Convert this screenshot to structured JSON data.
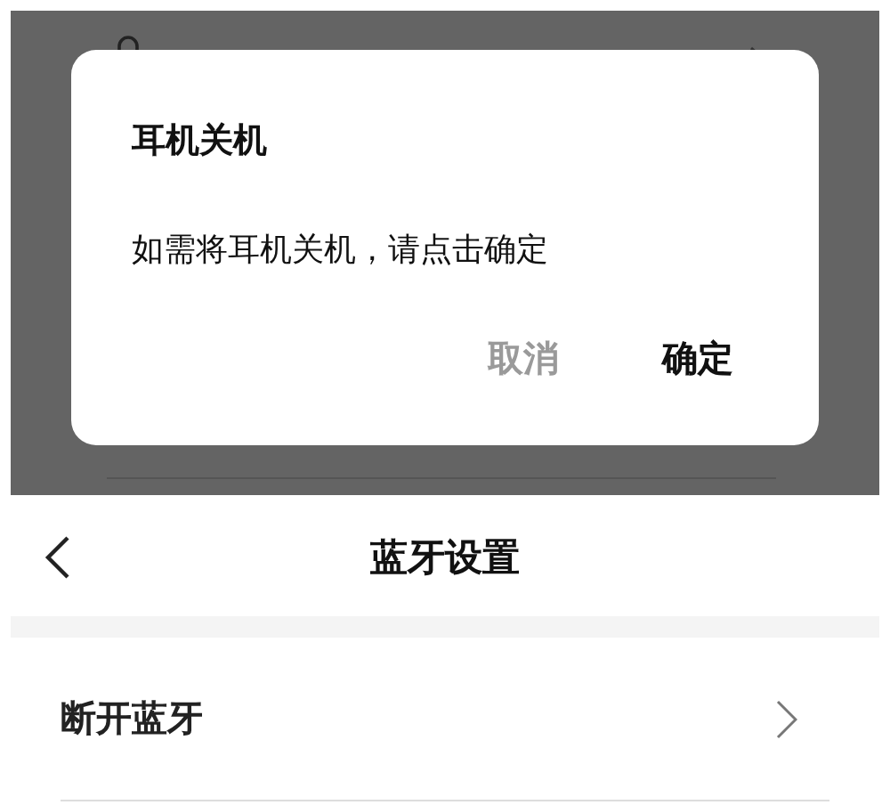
{
  "dialog": {
    "title": "耳机关机",
    "message": "如需将耳机关机，请点击确定",
    "buttons": [
      {
        "label": "取消",
        "kind": "secondary"
      },
      {
        "label": "确定",
        "kind": "primary"
      }
    ]
  },
  "header": {
    "title": "蓝牙设置"
  },
  "items": [
    {
      "label": "断开蓝牙"
    }
  ]
}
